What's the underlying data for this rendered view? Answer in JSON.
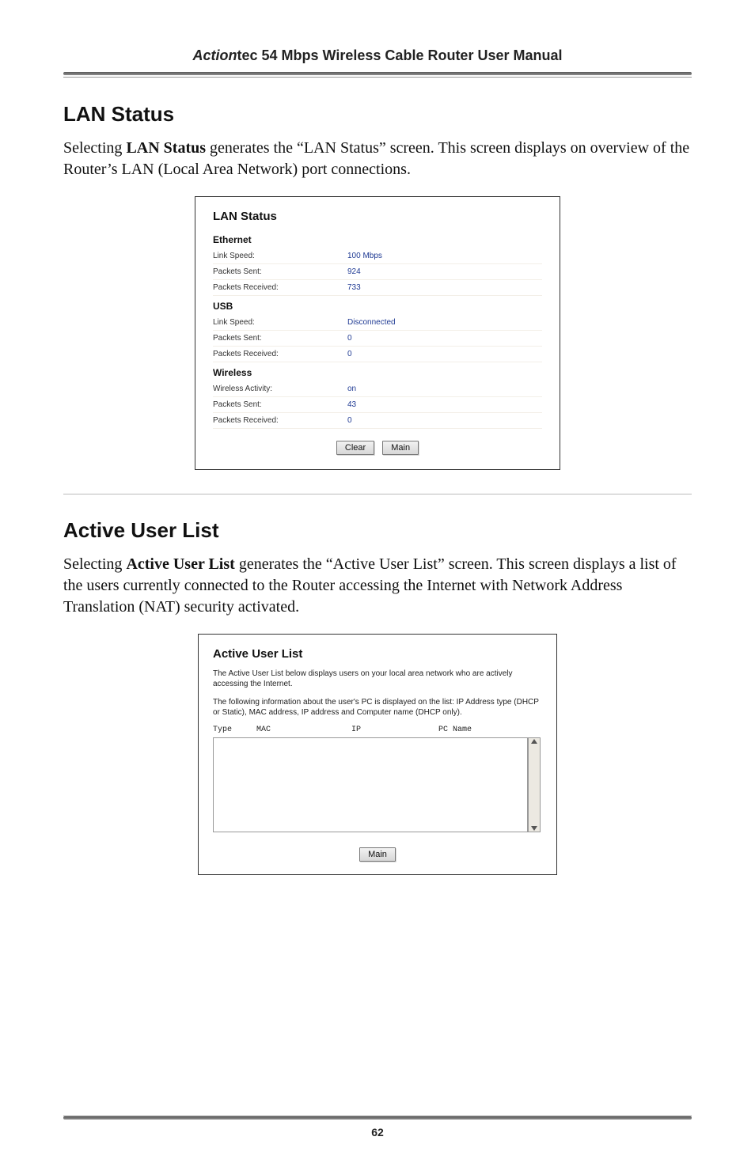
{
  "running_head": {
    "brand_italic": "Action",
    "brand_rest": "tec 54 Mbps Wireless Cable Router User Manual"
  },
  "sec1": {
    "heading": "LAN Status",
    "para_prefix": "Selecting ",
    "para_bold": "LAN Status",
    "para_mid1": " generates the “",
    "para_sc1": "LAN",
    "para_mid2": " Status” screen. This screen displays on overview of the Router’s ",
    "para_sc2": "LAN",
    "para_end": " (Local Area Network) port connections."
  },
  "shot1": {
    "title": "LAN Status",
    "groups": [
      {
        "label": "Ethernet",
        "rows": [
          {
            "k": "Link Speed:",
            "v": "100 Mbps"
          },
          {
            "k": "Packets Sent:",
            "v": "924"
          },
          {
            "k": "Packets Received:",
            "v": "733"
          }
        ]
      },
      {
        "label": "USB",
        "rows": [
          {
            "k": "Link Speed:",
            "v": "Disconnected"
          },
          {
            "k": "Packets Sent:",
            "v": "0"
          },
          {
            "k": "Packets Received:",
            "v": "0"
          }
        ]
      },
      {
        "label": "Wireless",
        "rows": [
          {
            "k": "Wireless Activity:",
            "v": "on"
          },
          {
            "k": "Packets Sent:",
            "v": "43"
          },
          {
            "k": "Packets Received:",
            "v": "0"
          }
        ]
      }
    ],
    "buttons": {
      "clear": "Clear",
      "main": "Main"
    }
  },
  "sec2": {
    "heading": "Active User List",
    "para_prefix": "Selecting ",
    "para_bold": "Active User List",
    "para_mid1": " generates the “Active User List” screen. This screen displays a list of the users currently connected to the Router accessing the Internet with Network Address Translation (",
    "para_sc1": "NAT",
    "para_end": ") security activated."
  },
  "shot2": {
    "title": "Active User List",
    "p1": "The Active User List below displays users on your local area network who are actively accessing the Internet.",
    "p2": "The following information about the user's PC is displayed on the list: IP Address type (DHCP or Static), MAC address, IP address and Computer name (DHCP only).",
    "cols": {
      "c1": "Type",
      "c2": "MAC",
      "c3": "IP",
      "c4": "PC Name"
    },
    "button_main": "Main"
  },
  "page_number": "62"
}
